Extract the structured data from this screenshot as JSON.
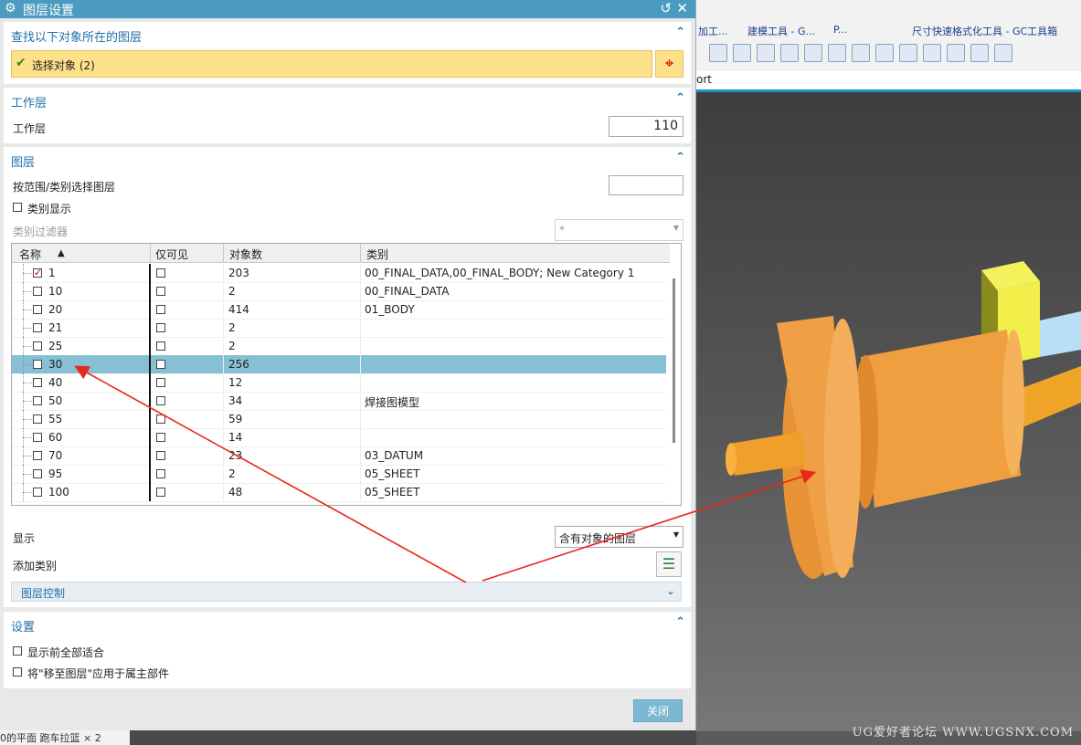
{
  "dialog": {
    "title": "图层设置",
    "find_section": {
      "heading": "查找以下对象所在的图层",
      "select_label": "选择对象 (2)"
    },
    "work_layer_section": {
      "heading": "工作层",
      "label": "工作层",
      "value": "110"
    },
    "layers_section": {
      "heading": "图层",
      "range_label": "按范围/类别选择图层",
      "range_value": "",
      "category_display_label": "类别显示",
      "category_filter_label": "类别过滤器",
      "category_filter_value": "*",
      "columns": {
        "name": "名称",
        "visible_only": "仅可见",
        "object_count": "对象数",
        "category": "类别"
      },
      "rows": [
        {
          "name": "1",
          "checked": true,
          "count": "203",
          "category": "00_FINAL_DATA,00_FINAL_BODY; New Category 1"
        },
        {
          "name": "10",
          "checked": false,
          "count": "2",
          "category": "00_FINAL_DATA"
        },
        {
          "name": "20",
          "checked": false,
          "count": "414",
          "category": "01_BODY"
        },
        {
          "name": "21",
          "checked": false,
          "count": "2",
          "category": ""
        },
        {
          "name": "25",
          "checked": false,
          "count": "2",
          "category": ""
        },
        {
          "name": "30",
          "checked": false,
          "count": "256",
          "category": "",
          "selected": true
        },
        {
          "name": "40",
          "checked": false,
          "count": "12",
          "category": ""
        },
        {
          "name": "50",
          "checked": false,
          "count": "34",
          "category": "焊接图模型"
        },
        {
          "name": "55",
          "checked": false,
          "count": "59",
          "category": ""
        },
        {
          "name": "60",
          "checked": false,
          "count": "14",
          "category": ""
        },
        {
          "name": "70",
          "checked": false,
          "count": "23",
          "category": "03_DATUM"
        },
        {
          "name": "95",
          "checked": false,
          "count": "2",
          "category": "05_SHEET"
        },
        {
          "name": "100",
          "checked": false,
          "count": "48",
          "category": "05_SHEET"
        }
      ],
      "display_label": "显示",
      "display_value": "含有对象的图层",
      "add_category_label": "添加类别",
      "layer_control_label": "图层控制"
    },
    "settings_section": {
      "heading": "设置",
      "fit_all_label": "显示前全部适合",
      "apply_owner_label": "将\"移至图层\"应用于属主部件"
    },
    "close_label": "关闭"
  },
  "viewport": {
    "tool_labels": [
      "加工...",
      "建模工具 - G...",
      "P...",
      "尺寸快速格式化工具 - GC工具箱"
    ],
    "tab_label": "ort",
    "watermark": "UG爱好者论坛 WWW.UGSNX.COM"
  },
  "bottom_tab": "0的平面 跑车拉篮 × 2"
}
